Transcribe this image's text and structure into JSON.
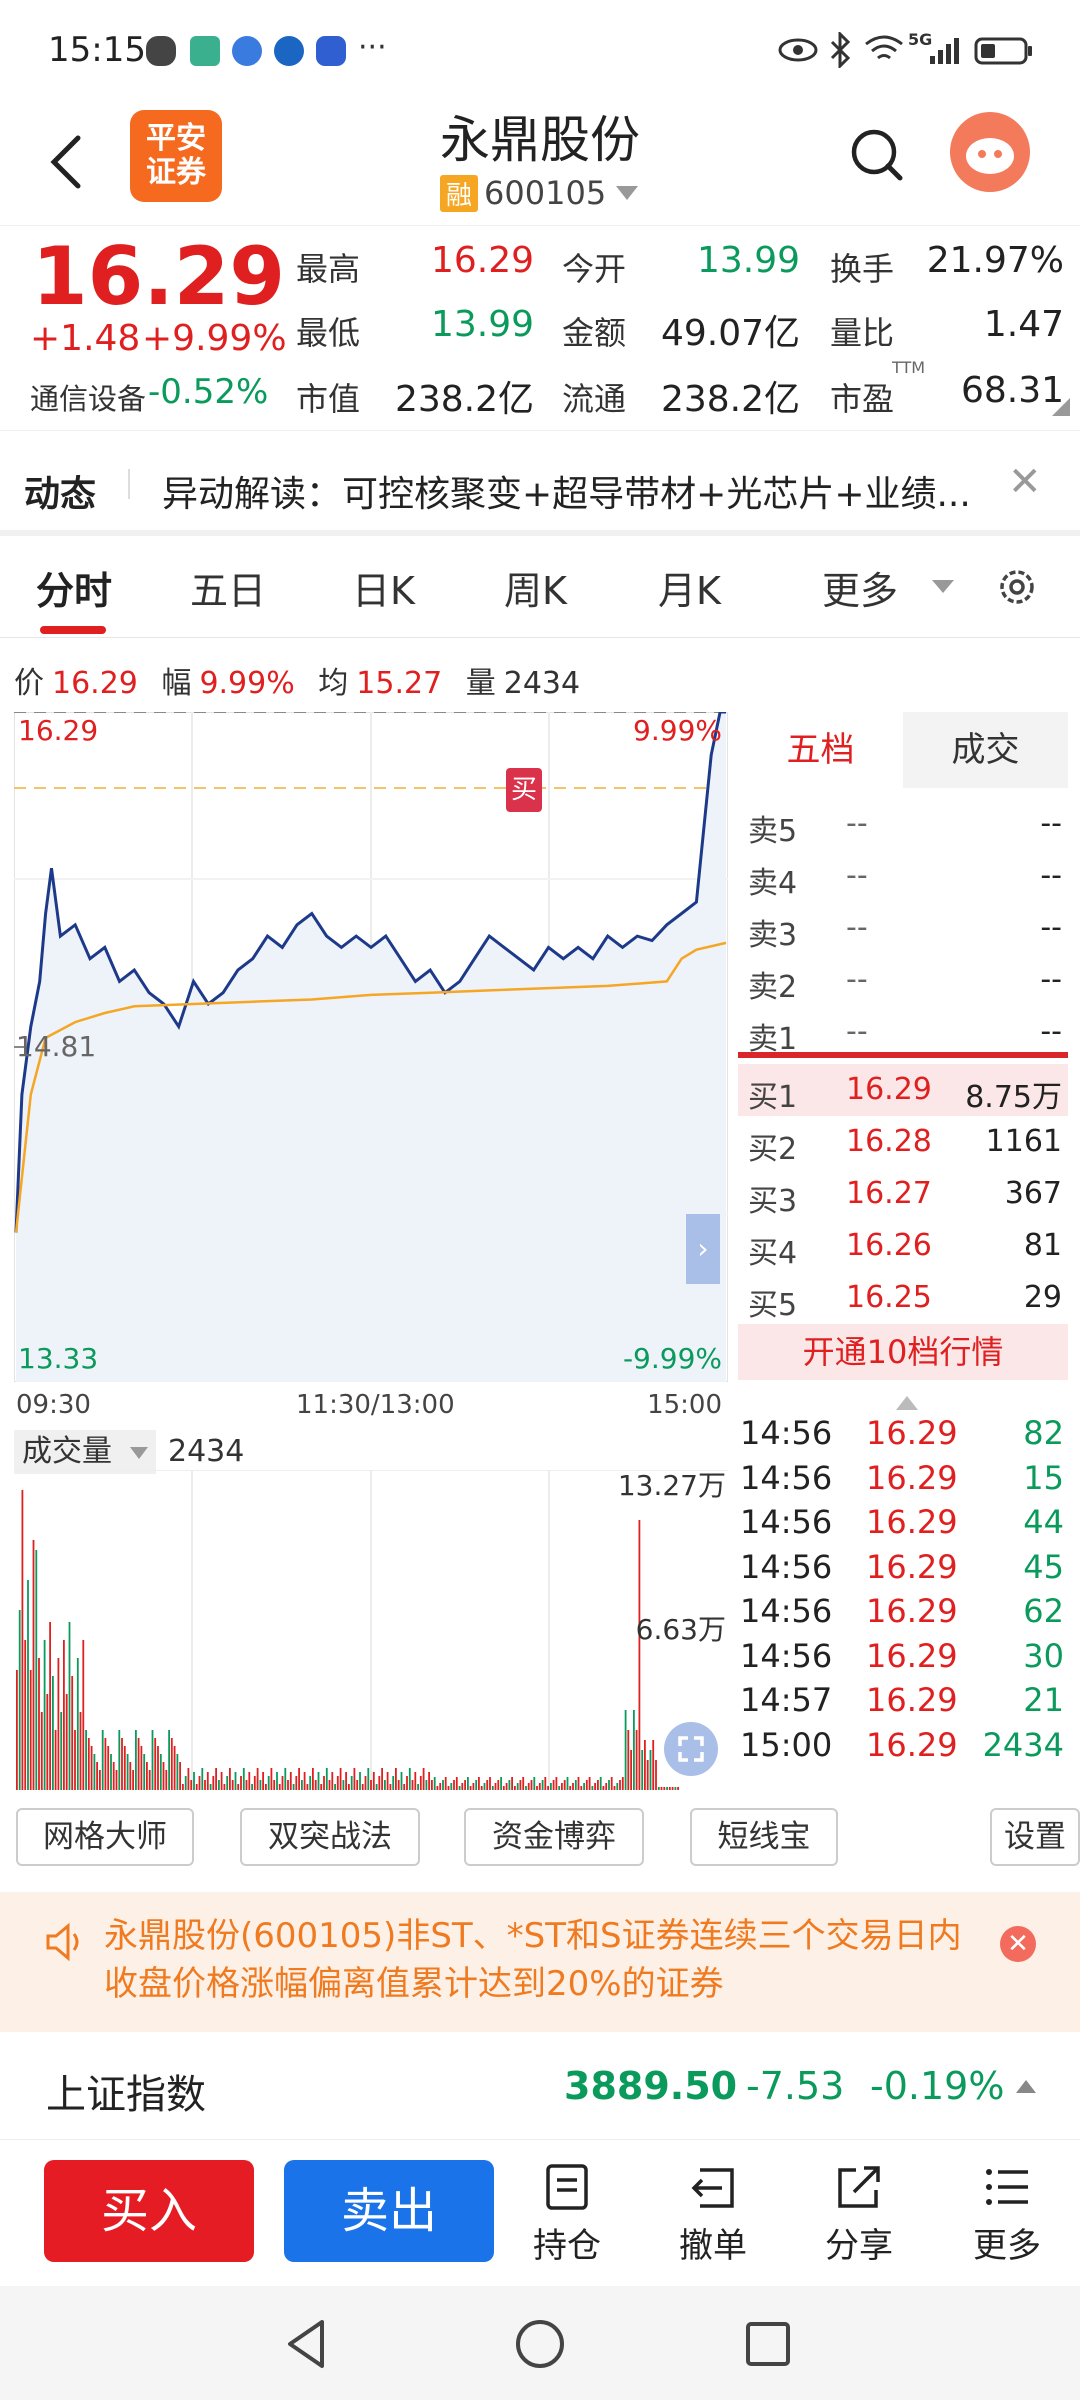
{
  "status_bar": {
    "time": "15:15",
    "network": "5G"
  },
  "header": {
    "logo_text": "平安证券",
    "title": "永鼎股份",
    "margin_tag": "融",
    "code": "600105"
  },
  "quote": {
    "price": "16.29",
    "change": "+1.48",
    "change_pct": "+9.99%",
    "sector_name": "通信设备",
    "sector_change": "-0.52%",
    "stats": [
      {
        "label": "最高",
        "value": "16.29",
        "color": "red"
      },
      {
        "label": "今开",
        "value": "13.99",
        "color": "green"
      },
      {
        "label": "换手",
        "value": "21.97%",
        "color": "black"
      },
      {
        "label": "最低",
        "value": "13.99",
        "color": "green"
      },
      {
        "label": "金额",
        "value": "49.07亿",
        "color": "black"
      },
      {
        "label": "量比",
        "value": "1.47",
        "color": "black"
      },
      {
        "label": "市值",
        "value": "238.2亿",
        "color": "black"
      },
      {
        "label": "流通",
        "value": "238.2亿",
        "color": "black"
      },
      {
        "label": "市盈",
        "value": "68.31",
        "color": "black"
      }
    ],
    "ttm": "TTM"
  },
  "news": {
    "label": "动态",
    "text": "异动解读：可控核聚变+超导带材+光芯片+业绩..."
  },
  "tabs": [
    "分时",
    "五日",
    "日K",
    "周K",
    "月K",
    "更多"
  ],
  "info_line": {
    "price_label": "价",
    "price": "16.29",
    "amp_label": "幅",
    "amp": "9.99%",
    "avg_label": "均",
    "avg": "15.27",
    "vol_label": "量",
    "vol": "2434"
  },
  "chart_labels": {
    "top_price": "16.29",
    "top_pct": "9.99%",
    "mid_price": "14.81",
    "bottom_price": "13.33",
    "bottom_pct": "-9.99%",
    "buy_marker": "买",
    "time_start": "09:30",
    "time_mid": "11:30/13:00",
    "time_end": "15:00"
  },
  "chart_data": {
    "type": "line",
    "title": "",
    "ylim": [
      13.33,
      16.29
    ],
    "reference_price": 14.81,
    "series": [
      {
        "x": [
          0,
          2,
          5,
          8,
          10,
          12,
          15,
          20,
          25,
          30,
          35,
          40,
          45,
          50,
          55,
          60,
          65,
          70,
          75,
          80,
          85,
          90,
          95,
          100,
          105,
          110,
          115,
          120,
          125,
          130,
          135,
          140,
          145,
          150,
          155,
          160,
          165,
          170,
          175,
          180,
          185,
          190,
          195,
          200,
          205,
          210,
          215,
          220,
          225,
          230,
          235,
          238,
          240
        ],
        "values": [
          13.99,
          14.6,
          14.9,
          15.1,
          15.4,
          15.6,
          15.3,
          15.35,
          15.2,
          15.25,
          15.1,
          15.15,
          15.05,
          15.0,
          14.9,
          15.1,
          15.0,
          15.05,
          15.15,
          15.2,
          15.3,
          15.25,
          15.35,
          15.4,
          15.3,
          15.25,
          15.3,
          15.25,
          15.3,
          15.2,
          15.1,
          15.15,
          15.05,
          15.1,
          15.2,
          15.3,
          15.25,
          15.2,
          15.15,
          15.25,
          15.2,
          15.25,
          15.2,
          15.3,
          15.25,
          15.3,
          15.28,
          15.35,
          15.4,
          15.45,
          16.1,
          16.29,
          16.29
        ]
      },
      {
        "x": [
          0,
          5,
          10,
          20,
          30,
          40,
          60,
          80,
          100,
          120,
          140,
          160,
          180,
          200,
          220,
          225,
          230,
          240
        ],
        "values": [
          13.99,
          14.6,
          14.85,
          14.92,
          14.96,
          14.99,
          15.0,
          15.01,
          15.02,
          15.04,
          15.05,
          15.06,
          15.07,
          15.08,
          15.1,
          15.2,
          15.24,
          15.27
        ]
      }
    ]
  },
  "order_book": {
    "tabs": [
      "五档",
      "成交"
    ],
    "asks": [
      {
        "label": "卖5",
        "price": "--",
        "qty": "--"
      },
      {
        "label": "卖4",
        "price": "--",
        "qty": "--"
      },
      {
        "label": "卖3",
        "price": "--",
        "qty": "--"
      },
      {
        "label": "卖2",
        "price": "--",
        "qty": "--"
      },
      {
        "label": "卖1",
        "price": "--",
        "qty": "--"
      }
    ],
    "bids": [
      {
        "label": "买1",
        "price": "16.29",
        "qty": "8.75万"
      },
      {
        "label": "买2",
        "price": "16.28",
        "qty": "1161"
      },
      {
        "label": "买3",
        "price": "16.27",
        "qty": "367"
      },
      {
        "label": "买4",
        "price": "16.26",
        "qty": "81"
      },
      {
        "label": "买5",
        "price": "16.25",
        "qty": "29"
      }
    ],
    "open10": "开通10档行情"
  },
  "volume": {
    "selector": "成交量",
    "value": "2434",
    "max_label": "13.27万",
    "mid_label": "6.63万"
  },
  "trades": [
    {
      "time": "14:56",
      "price": "16.29",
      "qty": "82",
      "side": "buy"
    },
    {
      "time": "14:56",
      "price": "16.29",
      "qty": "15",
      "side": "buy"
    },
    {
      "time": "14:56",
      "price": "16.29",
      "qty": "44",
      "side": "buy"
    },
    {
      "time": "14:56",
      "price": "16.29",
      "qty": "45",
      "side": "buy"
    },
    {
      "time": "14:56",
      "price": "16.29",
      "qty": "62",
      "side": "buy"
    },
    {
      "time": "14:56",
      "price": "16.29",
      "qty": "30",
      "side": "buy"
    },
    {
      "time": "14:57",
      "price": "16.29",
      "qty": "21",
      "side": "buy"
    },
    {
      "time": "15:00",
      "price": "16.29",
      "qty": "2434",
      "side": "buy"
    }
  ],
  "strategies": [
    "网格大师",
    "双突战法",
    "资金博弈",
    "短线宝",
    "设置"
  ],
  "alert": {
    "text": "永鼎股份(600105)非ST、*ST和S证券连续三个交易日内收盘价格涨幅偏离值累计达到20%的证券"
  },
  "index": {
    "name": "上证指数",
    "value": "3889.50",
    "change": "-7.53",
    "change_pct": "-0.19%"
  },
  "actions": {
    "buy": "买入",
    "sell": "卖出",
    "items": [
      "持仓",
      "撤单",
      "分享",
      "更多"
    ]
  },
  "colors": {
    "up": "#e02020",
    "down": "#0a9a5c",
    "price_line": "#1d3a8a",
    "avg_line": "#f5a623",
    "brand": "#f56a1f",
    "buy_button": "#e51c23",
    "sell_button": "#1a73e8"
  }
}
